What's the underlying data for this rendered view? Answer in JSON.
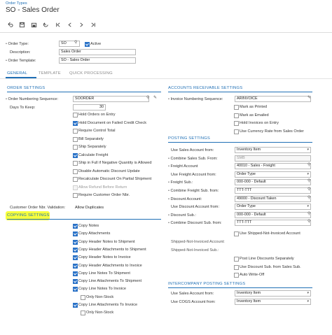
{
  "breadcrumb": "Order Types",
  "page_title": "SO - Sales Order",
  "toolbar": {
    "icons": [
      "undo-icon",
      "save-icon",
      "copy-icon",
      "cancel-icon",
      "first-icon",
      "prev-icon",
      "next-icon",
      "last-icon"
    ]
  },
  "header": {
    "order_type_label": "Order Type:",
    "order_type_value": "SO",
    "active_label": "Active",
    "description_label": "Description:",
    "description_value": "Sales Order",
    "order_template_label": "Order Template:",
    "order_template_value": "SO - Sales Order"
  },
  "tabs": [
    {
      "label": "GENERAL",
      "active": true
    },
    {
      "label": "TEMPLATE",
      "active": false
    },
    {
      "label": "QUICK PROCESSING",
      "active": false
    }
  ],
  "order_settings": {
    "title": "ORDER SETTINGS",
    "numbering_label": "Order Numbering Sequence:",
    "numbering_value": "SOORDER",
    "days_label": "Days To Keep:",
    "days_value": "30",
    "checks": [
      {
        "label": "Hold Orders on Entry",
        "checked": false,
        "disabled": false
      },
      {
        "label": "Hold Document on Failed Credit Check",
        "checked": true,
        "disabled": false
      },
      {
        "label": "Require Control Total",
        "checked": false,
        "disabled": false
      },
      {
        "label": "Bill Separately",
        "checked": false,
        "disabled": false
      },
      {
        "label": "Ship Separately",
        "checked": false,
        "disabled": false
      },
      {
        "label": "Calculate Freight",
        "checked": true,
        "disabled": false
      },
      {
        "label": "Ship in Full if Negative Quantity is Allowed",
        "checked": false,
        "disabled": false
      },
      {
        "label": "Disable Automatic Discount Update",
        "checked": false,
        "disabled": false
      },
      {
        "label": "Recalculate Discount On Partial Shipment",
        "checked": false,
        "disabled": false
      },
      {
        "label": "Allow Refund Before Return",
        "checked": false,
        "disabled": true
      },
      {
        "label": "Require Customer Order Nbr.",
        "checked": false,
        "disabled": false
      }
    ],
    "validation_label": "Customer Order Nbr. Validation:",
    "validation_value": "Allow Duplicates"
  },
  "copying_settings": {
    "title": "COPYING SETTINGS",
    "checks": [
      {
        "label": "Copy Notes",
        "checked": true,
        "indent": false
      },
      {
        "label": "Copy Attachments",
        "checked": true,
        "indent": false
      },
      {
        "label": "Copy Header Notes to Shipment",
        "checked": true,
        "indent": false
      },
      {
        "label": "Copy Header Attachments to Shipment",
        "checked": true,
        "indent": false
      },
      {
        "label": "Copy Header Notes to Invoice",
        "checked": true,
        "indent": false
      },
      {
        "label": "Copy Header Attachments to Invoice",
        "checked": true,
        "indent": false
      },
      {
        "label": "Copy Line Notes To Shipment",
        "checked": true,
        "indent": false
      },
      {
        "label": "Copy Line Attachments To Shipment",
        "checked": true,
        "indent": false
      },
      {
        "label": "Copy Line Notes To Invoice",
        "checked": true,
        "indent": false
      },
      {
        "label": "Only Non-Stock",
        "checked": false,
        "indent": true
      },
      {
        "label": "Copy Line Attachments To Invoice",
        "checked": true,
        "indent": false
      },
      {
        "label": "Only Non-Stock",
        "checked": false,
        "indent": true
      }
    ]
  },
  "ar_settings": {
    "title": "ACCOUNTS RECEIVABLE SETTINGS",
    "numbering_label": "Invoice Numbering Sequence:",
    "numbering_value": "ARINVOICE",
    "checks": [
      {
        "label": "Mark as Printed",
        "checked": false
      },
      {
        "label": "Mark as Emailed",
        "checked": false
      },
      {
        "label": "Hold Invoices on Entry",
        "checked": false
      },
      {
        "label": "Use Currency Rate from Sales Order",
        "checked": false
      }
    ]
  },
  "posting_settings": {
    "title": "POSTING SETTINGS",
    "rows": [
      {
        "label": "Use Sales Account from:",
        "value": "Inventory Item",
        "required": false,
        "select": true
      },
      {
        "label": "Combine Sales Sub. From:",
        "value": "SMB",
        "required": true,
        "select": false,
        "muted": true
      },
      {
        "label": "Freight Account",
        "value": "40010 - Sales - Freight",
        "required": true,
        "select": false
      },
      {
        "label": "Use Freight Account from:",
        "value": "Order Type",
        "required": false,
        "select": true
      },
      {
        "label": "Freight Sub.:",
        "value": "000-000 - Default",
        "required": true,
        "select": false
      },
      {
        "label": "Combine Freight Sub. from:",
        "value": "TTT-TTT",
        "required": true,
        "select": false
      },
      {
        "label": "Discount Account:",
        "value": "49000 - Discount Taken",
        "required": true,
        "select": false
      },
      {
        "label": "Use Discount Account from:",
        "value": "Order Type",
        "required": false,
        "select": true
      },
      {
        "label": "Discount Sub.:",
        "value": "000-000 - Default",
        "required": true,
        "select": false
      },
      {
        "label": "Combine Discount Sub. from:",
        "value": "TTT-TTT",
        "required": true,
        "select": false
      }
    ],
    "shipped_check": "Use Shipped-Not-Invoiced Account",
    "shipped_account_label": "Shipped-Not-Invoiced Account:",
    "shipped_sub_label": "Shipped-Not-Invoiced Sub.:",
    "checks": [
      {
        "label": "Post Line Discounts Separately",
        "checked": false
      },
      {
        "label": "Use Discount Sub. from Sales Sub.",
        "checked": false
      },
      {
        "label": "Auto Write-Off",
        "checked": false
      }
    ]
  },
  "intercompany": {
    "title": "INTERCOMPANY POSTING SETTINGS",
    "rows": [
      {
        "label": "Use Sales Account from:",
        "value": "Inventory Item"
      },
      {
        "label": "Use COGS Account from:",
        "value": "Inventory Item"
      }
    ]
  }
}
